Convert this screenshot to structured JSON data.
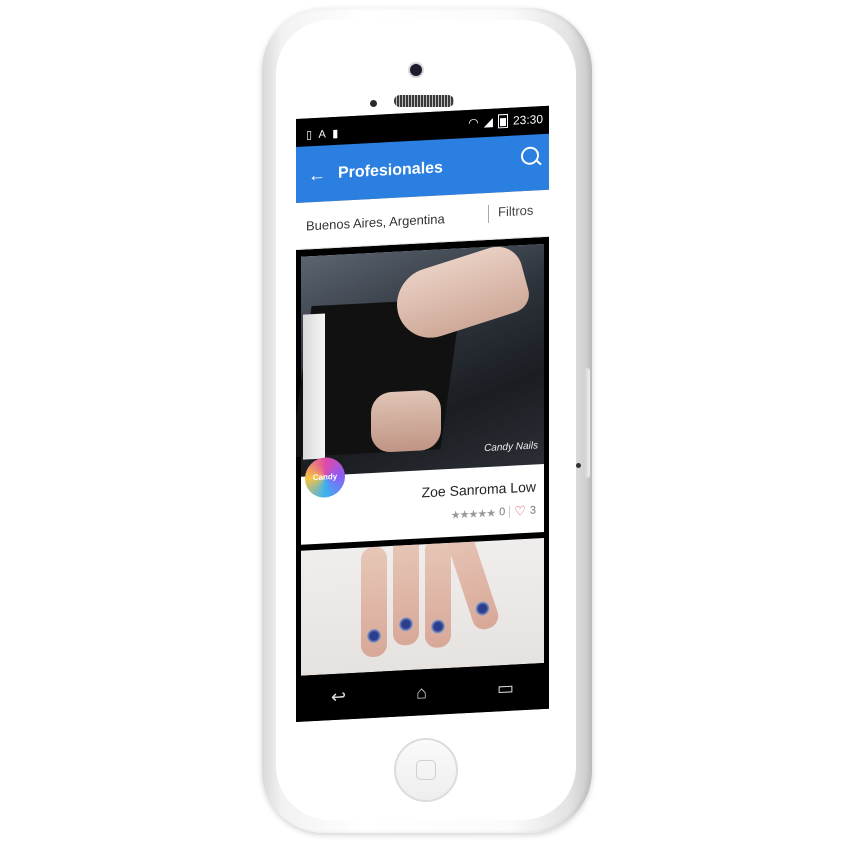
{
  "status_bar": {
    "time": "23:30",
    "left_icons": "▯ A ▮"
  },
  "app_bar": {
    "title": "Profesionales",
    "back_glyph": "←"
  },
  "filter_bar": {
    "location": "Buenos Aires, Argentina",
    "filters_label": "Filtros"
  },
  "card": {
    "watermark": "Candy Nails",
    "logo_text": "Candy Nails",
    "name": "Zoe Sanroma Low",
    "rating_stars": "★★★★★",
    "rating_count": "0",
    "likes": "3"
  },
  "navbar": {
    "back_glyph": "↩",
    "home_glyph": "⌂",
    "recents_glyph": "▭"
  },
  "colors": {
    "accent": "#2a7fe0",
    "heart": "#e24444"
  }
}
